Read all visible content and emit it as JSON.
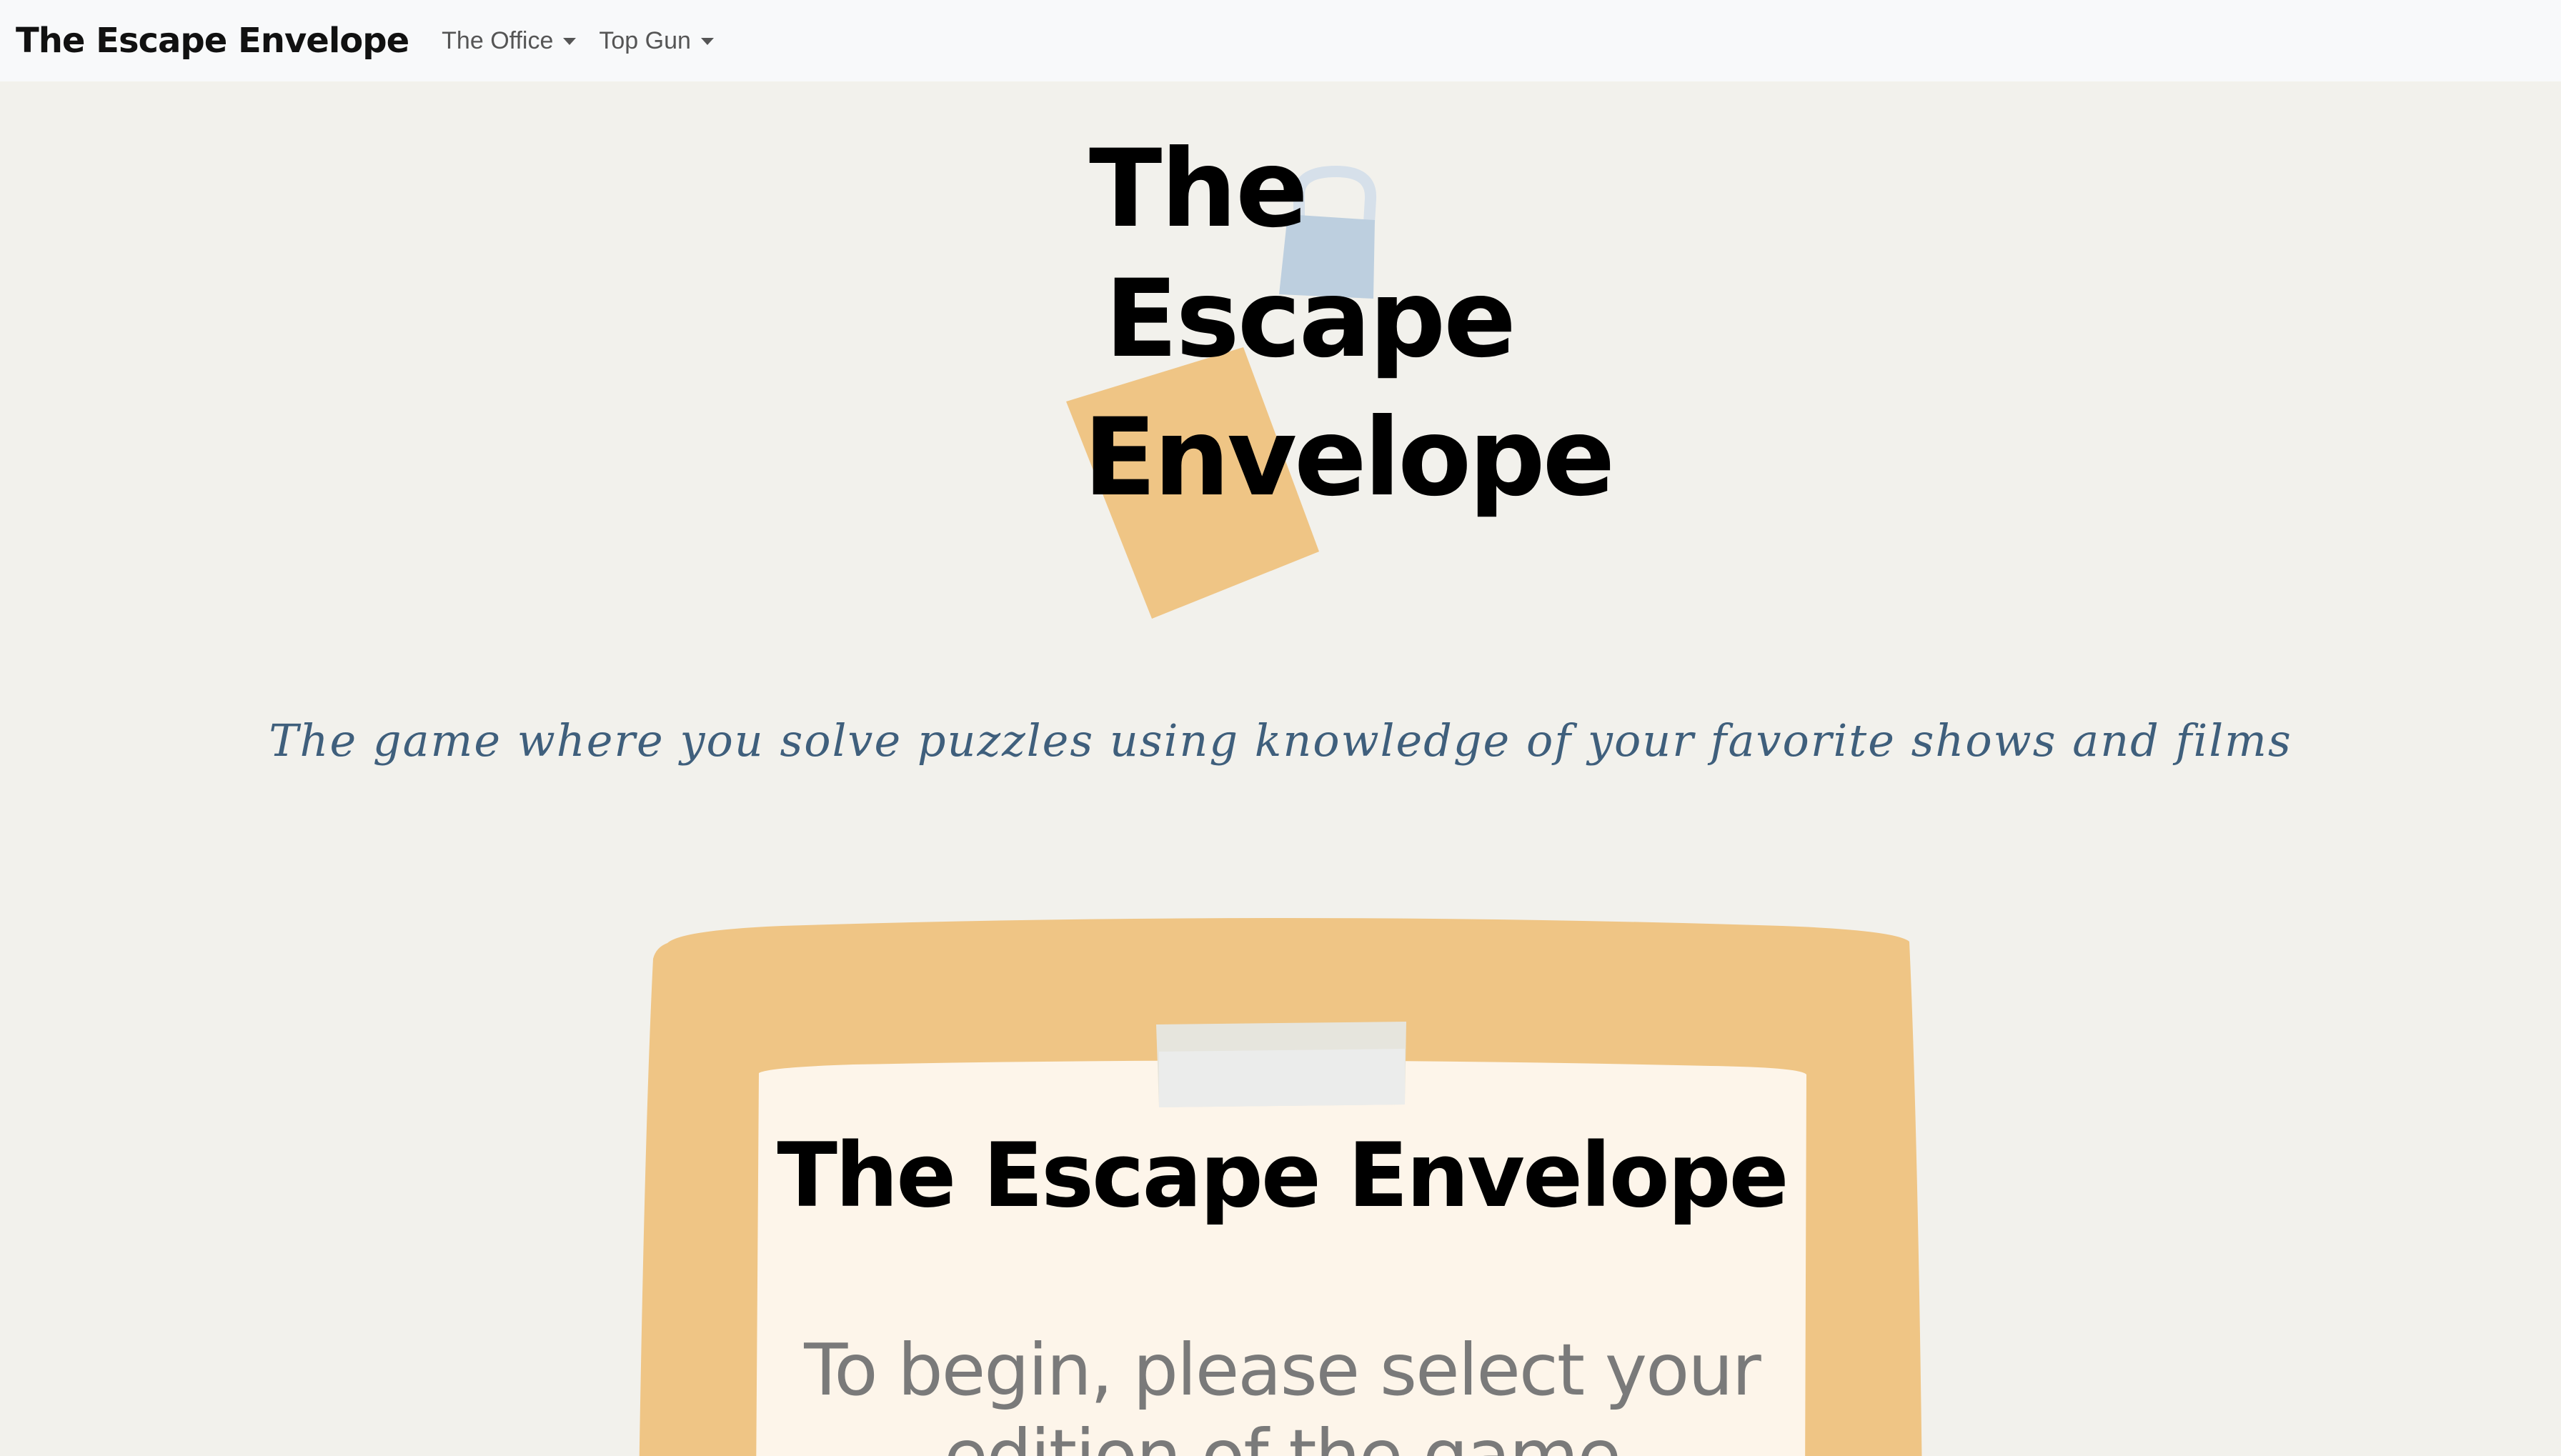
{
  "navbar": {
    "brand": "The Escape Envelope",
    "menus": [
      {
        "label": "The Office"
      },
      {
        "label": "Top Gun"
      }
    ]
  },
  "hero": {
    "logo_lines": [
      "The",
      "Escape",
      "Envelope"
    ],
    "tagline": "The game where you solve puzzles using knowledge of your favorite shows and films"
  },
  "card": {
    "title": "The Escape Envelope",
    "text": "To begin, please select your edition of the game"
  },
  "colors": {
    "page_bg": "#f2f1ec",
    "navbar_bg": "#f8f9fa",
    "envelope": "#efc585",
    "paper": "#fdf5ea",
    "tape": "#e6e5dd",
    "lock": "#bdcfdf",
    "tagline": "#3f5f7c"
  }
}
